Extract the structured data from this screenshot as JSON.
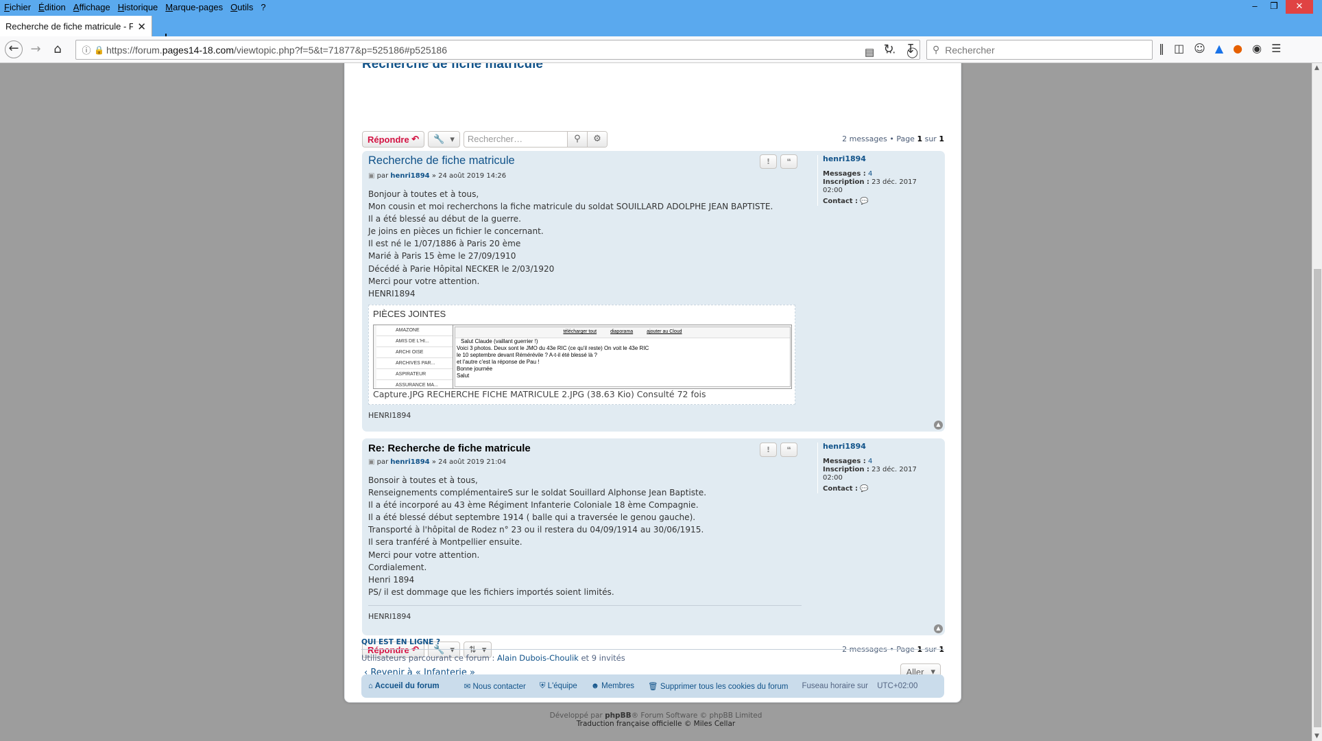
{
  "window": {
    "menus": [
      "Fichier",
      "Édition",
      "Affichage",
      "Historique",
      "Marque-pages",
      "Outils",
      "?"
    ],
    "controls": {
      "minimize": "–",
      "restore": "❐",
      "close": "✕"
    }
  },
  "tab": {
    "title": "Recherche de fiche matricule - Fori",
    "close": "✕",
    "new": "+"
  },
  "url": {
    "prefix": "https://forum.",
    "domain": "pages14-18.com",
    "path": "/viewtopic.php?f=5&t=71877&p=525186#p525186"
  },
  "search": {
    "placeholder": "Rechercher"
  },
  "topic": {
    "title": "Recherche de fiche matricule"
  },
  "actionbar": {
    "reply": "Répondre",
    "search_placeholder": "Rechercher…"
  },
  "pagination": {
    "count": "2 messages",
    "page_label": "Page",
    "page": "1",
    "sur": "sur",
    "total": "1"
  },
  "posts": [
    {
      "title": "Recherche de fiche matricule",
      "par": "par",
      "author": "henri1894",
      "date": "» 24 août 2019 14:26",
      "lines": [
        "Bonjour à toutes et à tous,",
        "Mon cousin et moi recherchons la fiche matricule du soldat SOUILLARD ADOLPHE JEAN BAPTISTE.",
        "Il a été blessé au début de la guerre.",
        "Je joins en pièces un fichier le concernant.",
        "Il est né le 1/07/1886 à Paris 20 ème",
        "Marié à Paris 15 ème le 27/09/1910",
        "Décédé à Parie Hôpital NECKER le 2/03/1920",
        "Merci pour votre attention.",
        "HENRI1894"
      ],
      "attachments": {
        "heading": "PIÈCES JOINTES",
        "thumb_left": [
          "AMAZONE",
          "AMIS DE L'HI...",
          "ARCHI OISE",
          "ARCHIVES PAR...",
          "ASPIRATEUR",
          "ASSURANCE MA..."
        ],
        "thumb_links": [
          "télécharger tout",
          "diaporama",
          "ajouter au Cloud"
        ],
        "thumb_text": [
          "Salut Claude (vaillant guerrier !)",
          "Voici 3 photos. Deux sont le JMO du 43e RIC (ce qu'il reste) On voit le 43e RIC",
          "le 10 septembre devant Rémérévile ? A-t-il été blessé là ?",
          "et l'autre c'est la réponse de Pau !",
          "Bonne journée",
          "Salut"
        ],
        "caption": "Capture.JPG RECHERCHE FICHE MATRICULE 2.JPG (38.63 Kio) Consulté 72 fois"
      },
      "signature": "HENRI1894",
      "profile": {
        "name": "henri1894",
        "messages_label": "Messages :",
        "messages": "4",
        "inscription_label": "Inscription :",
        "inscription": "23 déc. 2017",
        "inscription_time": "02:00",
        "contact_label": "Contact :"
      }
    },
    {
      "title": "Re: Recherche de fiche matricule",
      "par": "par",
      "author": "henri1894",
      "date": "» 24 août 2019 21:04",
      "lines": [
        "Bonsoir à toutes et à tous,",
        "Renseignements complémentaireS sur le soldat Souillard Alphonse Jean Baptiste.",
        "Il a été incorporé au 43 ème Régiment Infanterie Coloniale 18 ème Compagnie.",
        "Il a été blessé début septembre 1914 ( balle qui a traversée le genou gauche).",
        "Transporté à l'hôpital de Rodez n° 23 ou il restera du 04/09/1914 au 30/06/1915.",
        "Il sera tranféré à Montpellier ensuite.",
        "Merci pour votre attention.",
        "Cordialement.",
        "Henri 1894",
        "PS/ il est dommage que les fichiers importés soient limités."
      ],
      "signature": "HENRI1894",
      "profile": {
        "name": "henri1894",
        "messages_label": "Messages :",
        "messages": "4",
        "inscription_label": "Inscription :",
        "inscription": "23 déc. 2017",
        "inscription_time": "02:00",
        "contact_label": "Contact :"
      }
    }
  ],
  "back": {
    "label": "Revenir à « Infanterie »"
  },
  "jump": {
    "label": "Aller"
  },
  "online": {
    "heading": "QUI EST EN LIGNE ?",
    "text": "Utilisateurs parcourant ce forum :",
    "user": "Alain Dubois-Choulik",
    "rest": "et 9 invités"
  },
  "footer": {
    "home": "Accueil du forum",
    "contact": "Nous contacter",
    "team": "L'équipe",
    "members": "Membres",
    "cookies": "Supprimer tous les cookies du forum",
    "timezone": "Fuseau horaire sur",
    "tz_value": "UTC+02:00"
  },
  "credits": {
    "line1_a": "Développé par",
    "phpbb": "phpBB",
    "line1_b": "® Forum Software © phpBB Limited",
    "line2": "Traduction française officielle © Miles Cellar"
  }
}
